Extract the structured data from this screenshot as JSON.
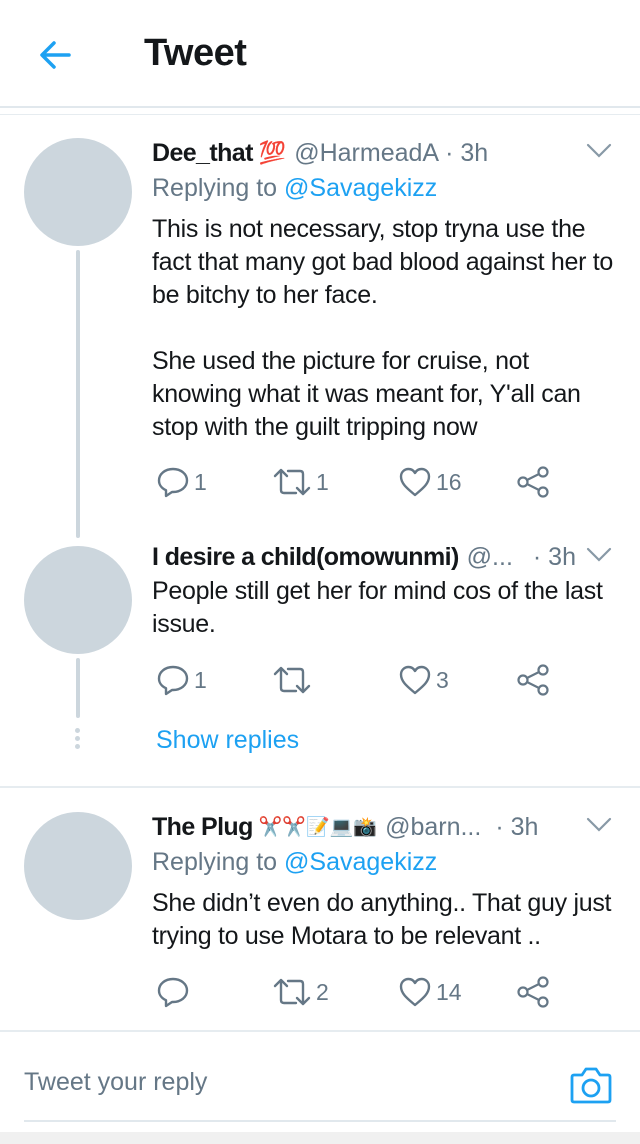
{
  "header": {
    "title": "Tweet"
  },
  "tweets": [
    {
      "name": "Dee_that",
      "name_emoji": "💯",
      "handle": "@HarmeadA",
      "time": "· 3h",
      "replying_prefix": "Replying to",
      "replying_to": "@Savagekizz",
      "body": [
        "This is not necessary, stop tryna use the fact that many got bad blood against her to be bitchy to her face.",
        "She used the picture for cruise, not knowing what it was meant for, Y'all can stop with the guilt tripping now"
      ],
      "replies": "1",
      "retweets": "1",
      "likes": "16"
    },
    {
      "name": "I desire a child(omowunmi)",
      "handle": "@...",
      "time": "· 3h",
      "body": [
        "People still get her for mind cos of the last issue."
      ],
      "replies": "1",
      "retweets": "",
      "likes": "3"
    },
    {
      "name": "The Plug",
      "name_emoji": "✂️✂️📝💻📸",
      "handle": "@barn...",
      "time": "· 3h",
      "replying_prefix": "Replying to",
      "replying_to": "@Savagekizz",
      "body": [
        "She didn’t even do anything.. That guy just trying to use Motara to be relevant .."
      ],
      "replies": "",
      "retweets": "2",
      "likes": "14"
    }
  ],
  "show_replies": "Show replies",
  "compose": {
    "placeholder": "Tweet your reply"
  },
  "colors": {
    "accent": "#1da1f2",
    "secondary_text": "#657786",
    "avatar_placeholder": "#ccd6dd"
  }
}
